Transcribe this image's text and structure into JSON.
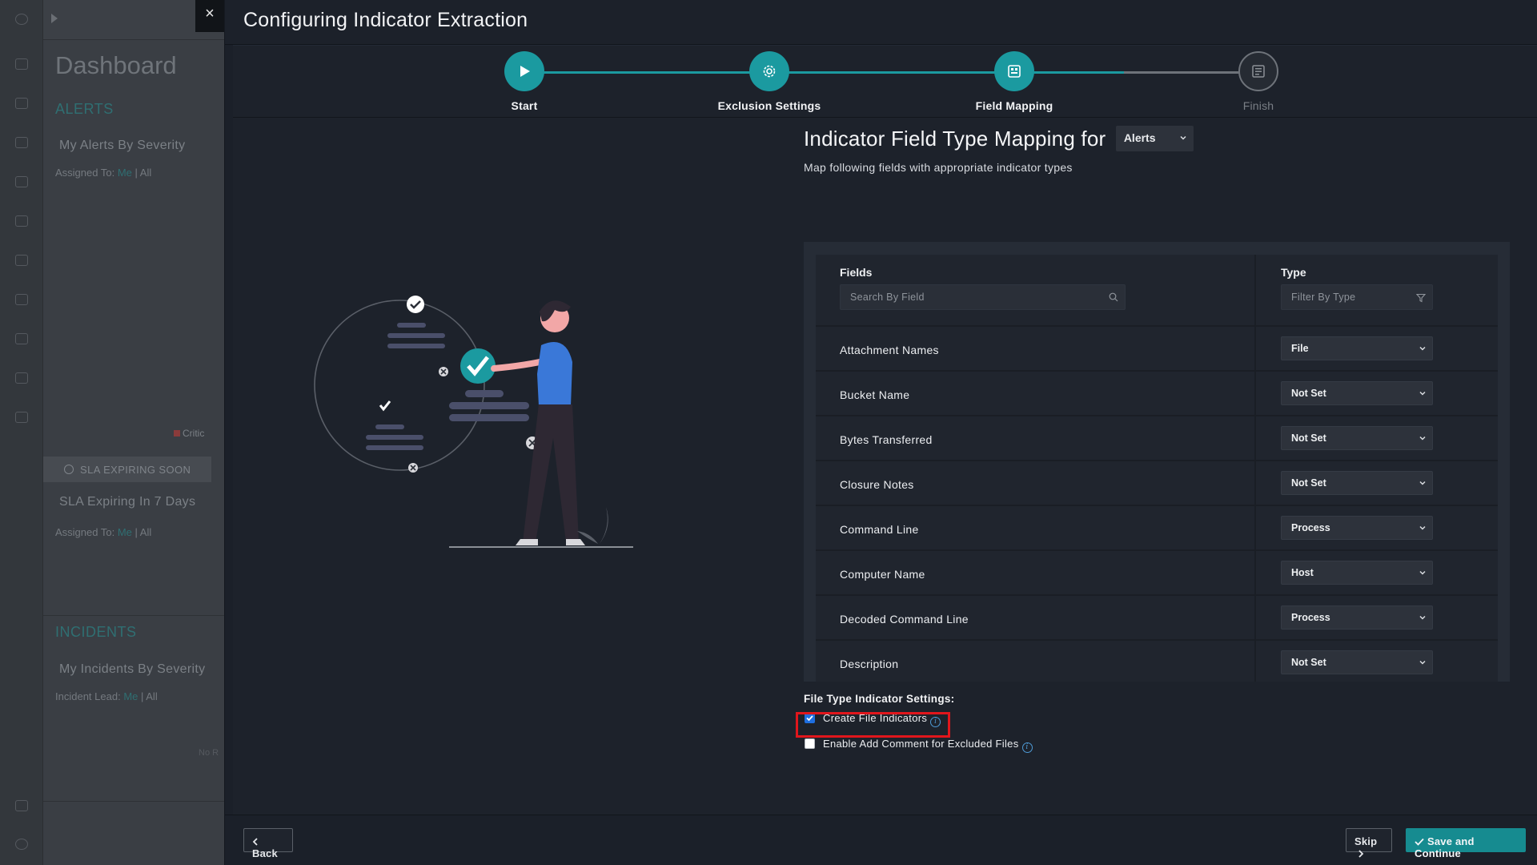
{
  "background": {
    "dashboard_title": "Dashboard",
    "alerts_section": "ALERTS",
    "alerts_card": "My Alerts By Severity",
    "alerts_assigned_label": "Assigned To:",
    "assigned_me": "Me",
    "assigned_sep": " | ",
    "assigned_all": "All",
    "sla_bar": "SLA EXPIRING SOON",
    "sla_card": "SLA Expiring In 7 Days",
    "incidents_section": "INCIDENTS",
    "incidents_card": "My Incidents By Severity",
    "incident_lead_label": "Incident Lead:",
    "legend_crit": "Critic",
    "no_records": "No R"
  },
  "modal": {
    "title": "Configuring Indicator Extraction",
    "close_glyph": "×"
  },
  "stepper": {
    "steps": [
      {
        "label": "Start",
        "icon": "play-icon",
        "state": "done"
      },
      {
        "label": "Exclusion Settings",
        "icon": "gear-icon",
        "state": "done"
      },
      {
        "label": "Field Mapping",
        "icon": "mapping-icon",
        "state": "active"
      },
      {
        "label": "Finish",
        "icon": "finish-icon",
        "state": "todo"
      }
    ]
  },
  "mapping": {
    "title": "Indicator Field Type Mapping for",
    "entity_select": "Alerts",
    "subtitle": "Map following fields with appropriate indicator types",
    "col_fields": "Fields",
    "col_type": "Type",
    "search_placeholder": "Search By Field",
    "filter_placeholder": "Filter By Type",
    "rows": [
      {
        "field": "Attachment Names",
        "type": "File"
      },
      {
        "field": "Bucket Name",
        "type": "Not Set"
      },
      {
        "field": "Bytes Transferred",
        "type": "Not Set"
      },
      {
        "field": "Closure Notes",
        "type": "Not Set"
      },
      {
        "field": "Command Line",
        "type": "Process"
      },
      {
        "field": "Computer Name",
        "type": "Host"
      },
      {
        "field": "Decoded Command Line",
        "type": "Process"
      },
      {
        "field": "Description",
        "type": "Not Set"
      }
    ]
  },
  "file_settings": {
    "title": "File Type Indicator Settings:",
    "create_file_indicators": {
      "label": "Create File Indicators",
      "checked": true
    },
    "enable_add_comment": {
      "label": "Enable Add Comment for Excluded Files",
      "checked": false
    },
    "info_glyph": "i"
  },
  "footer": {
    "back": "Back",
    "skip": "Skip",
    "save": "Save and Continue"
  },
  "colors": {
    "accent": "#1b9aa0",
    "highlight": "#e0161c",
    "checkbox": "#1f6fe0"
  }
}
